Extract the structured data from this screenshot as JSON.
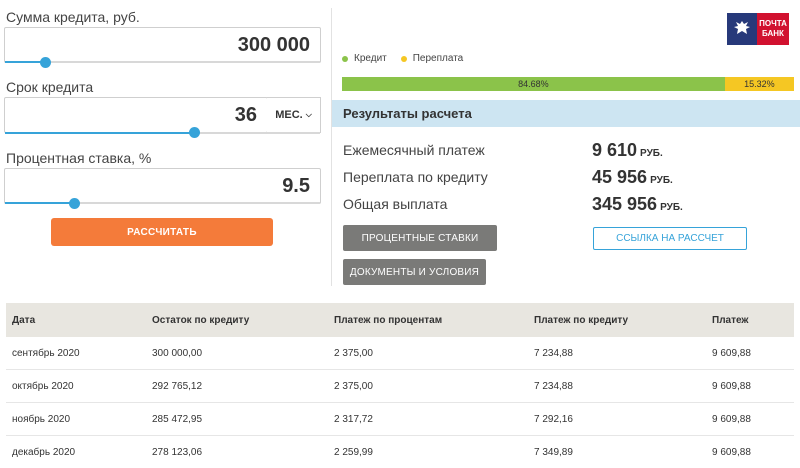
{
  "calculator": {
    "amount": {
      "label": "Сумма кредита, руб.",
      "value": "300 000",
      "slider_fraction": 0.13
    },
    "term": {
      "label": "Срок кредита",
      "value": "36",
      "unit": "МЕС.",
      "slider_fraction": 0.6
    },
    "rate": {
      "label": "Процентная ставка, %",
      "value": "9.5",
      "slider_fraction": 0.22
    },
    "calculate_label": "РАССЧИТАТЬ"
  },
  "brand": {
    "line1": "ПОЧТА",
    "line2": "БАНК",
    "emblem_color": "#27397a",
    "accent_color": "#d1112f"
  },
  "legend": [
    {
      "label": "Кредит",
      "color": "#8bc34a"
    },
    {
      "label": "Переплата",
      "color": "#f5c723"
    }
  ],
  "breakdown": {
    "credit_percent": 84.68,
    "credit_label": "84.68%",
    "overpay_percent": 15.32,
    "overpay_label": "15.32%"
  },
  "results": {
    "header": "Результаты расчета",
    "rows": [
      {
        "label": "Ежемесячный платеж",
        "value": "9 610",
        "unit": "РУБ."
      },
      {
        "label": "Переплата по кредиту",
        "value": "45 956",
        "unit": "РУБ."
      },
      {
        "label": "Общая выплата",
        "value": "345 956",
        "unit": "РУБ."
      }
    ],
    "rates_button": "ПРОЦЕНТНЫЕ СТАВКИ",
    "docs_button": "ДОКУМЕНТЫ И УСЛОВИЯ",
    "link_button": "ССЫЛКА НА РАССЧЕТ"
  },
  "schedule": {
    "columns": [
      "Дата",
      "Остаток по кредиту",
      "Платеж по процентам",
      "Платеж по кредиту",
      "Платеж"
    ],
    "rows": [
      [
        "сентябрь 2020",
        "300 000,00",
        "2 375,00",
        "7 234,88",
        "9 609,88"
      ],
      [
        "октябрь 2020",
        "292 765,12",
        "2 375,00",
        "7 234,88",
        "9 609,88"
      ],
      [
        "ноябрь 2020",
        "285 472,95",
        "2 317,72",
        "7 292,16",
        "9 609,88"
      ],
      [
        "декабрь 2020",
        "278 123,06",
        "2 259,99",
        "7 349,89",
        "9 609,88"
      ]
    ]
  }
}
